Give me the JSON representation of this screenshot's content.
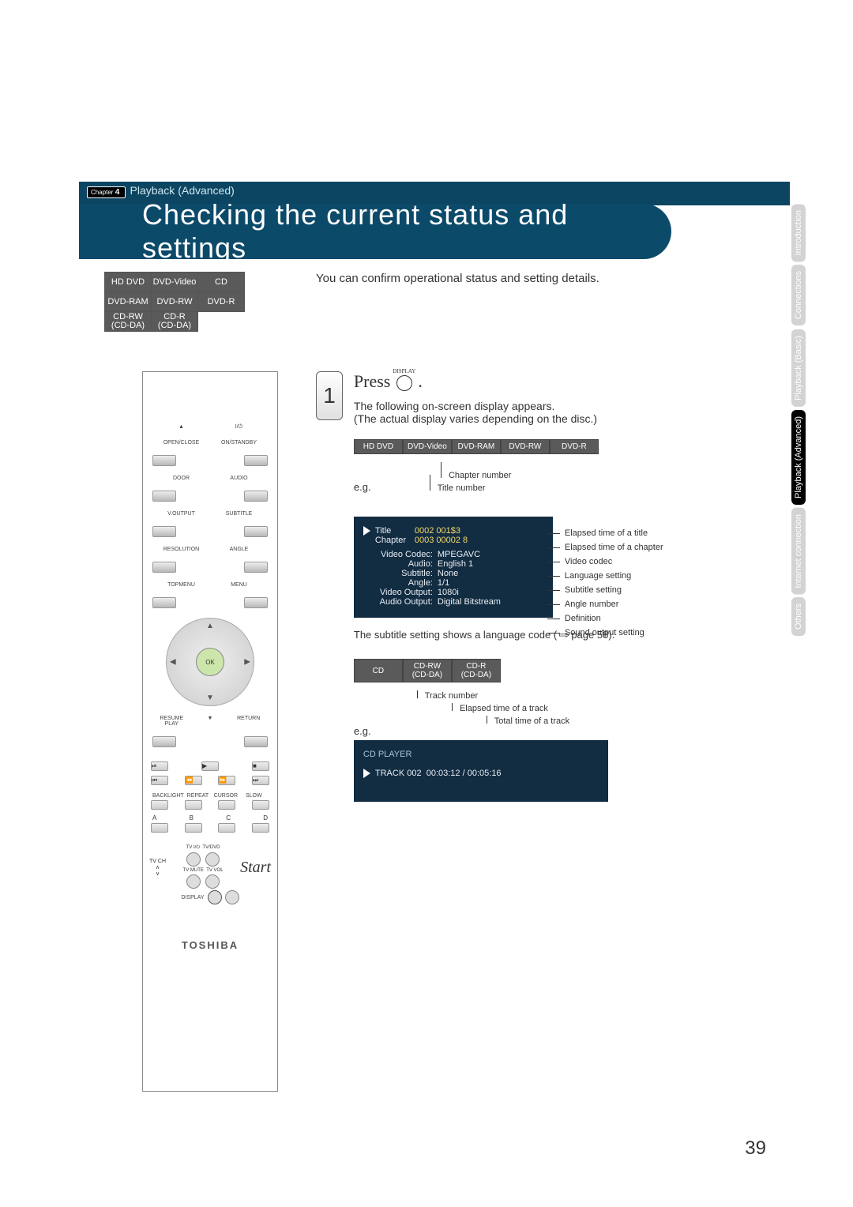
{
  "breadcrumb": {
    "chapter": "Chapter",
    "num": "4",
    "section": "Playback (Advanced)"
  },
  "title": "Checking the current status and settings",
  "intro": "You can confirm operational status and setting details.",
  "media_grid": [
    [
      "HD DVD",
      "DVD-Video",
      "CD"
    ],
    [
      "DVD-RAM",
      "DVD-RW",
      "DVD-R"
    ],
    [
      "CD-RW\n(CD-DA)",
      "CD-R\n(CD-DA)",
      ""
    ]
  ],
  "side_tabs": [
    "Introduction",
    "Connections",
    "Playback (Basic)",
    "Playback (Advanced)",
    "Internet connection",
    "Others"
  ],
  "active_tab_index": 3,
  "remote": {
    "row1": [
      "OPEN/CLOSE",
      "ON/STANDBY"
    ],
    "row2": [
      "DOOR",
      "AUDIO"
    ],
    "row3": [
      "V.OUTPUT",
      "SUBTITLE"
    ],
    "row4": [
      "RESOLUTION",
      "ANGLE"
    ],
    "row5": [
      "TOPMENU",
      "MENU"
    ],
    "ok": "OK",
    "resume": "RESUME PLAY",
    "return": "RETURN",
    "brow": [
      "BACKLIGHT",
      "REPEAT",
      "CURSOR",
      "SLOW"
    ],
    "abcd": [
      "A",
      "B",
      "C",
      "D"
    ],
    "tv_row": [
      "TV I/⏻",
      "TV/DVD"
    ],
    "tvch": "TV CH",
    "tvmute": "TV MUTE",
    "tvvol": "TV VOL",
    "display": "DISPLAY",
    "start": "Start",
    "brand": "TOSHIBA"
  },
  "step": {
    "number": "1",
    "press": "Press",
    "display_label": "DISPLAY",
    "desc1": "The following on-screen display appears.",
    "desc2": "(The actual display varies depending on the disc.)",
    "media_row": [
      "HD DVD",
      "DVD-Video",
      "DVD-RAM",
      "DVD-RW",
      "DVD-R"
    ],
    "eg": "e.g.",
    "leaders_top": [
      "Chapter number",
      "Title number"
    ],
    "osd1": {
      "title_lbl": "Title",
      "title_vals": "0002  001$3",
      "chapter_lbl": "Chapter",
      "chapter_vals": "0003  00002 8",
      "rows": [
        [
          "Video Codec:",
          "MPEGAVC"
        ],
        [
          "Audio:",
          "English 1"
        ],
        [
          "Subtitle:",
          "None"
        ],
        [
          "Angle:",
          "1/1"
        ],
        [
          "Video Output:",
          "1080i"
        ],
        [
          "Audio Output:",
          "Digital Bitstream"
        ]
      ]
    },
    "leaders_right": [
      "Elapsed time of a title",
      "Elapsed time of a chapter",
      "Video codec",
      "Language setting",
      "Subtitle setting",
      "Angle number",
      "Definition",
      "Sound output setting"
    ],
    "subtitle_note_pre": "The subtitle setting shows a language code (",
    "subtitle_note_post": " page 58).",
    "media_row2": [
      {
        "t": "CD"
      },
      {
        "t": "CD-RW",
        "s": "(CD-DA)"
      },
      {
        "t": "CD-R",
        "s": "(CD-DA)"
      }
    ],
    "leaders_track": [
      "Track number",
      "Elapsed time of a track",
      "Total time of a track"
    ],
    "eg2": "e.g.",
    "osd2": {
      "header": "CD PLAYER",
      "label": "TRACK",
      "num": "002",
      "elapsed": "00:03:12",
      "sep": "/",
      "total": "00:05:16"
    }
  },
  "page": "39"
}
